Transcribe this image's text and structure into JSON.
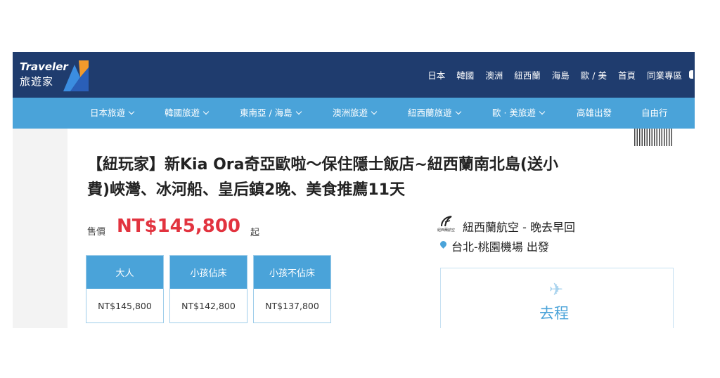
{
  "brand": {
    "name_en": "Traveler",
    "name_zh": "旅遊家"
  },
  "top_nav": [
    "日本",
    "韓國",
    "澳洲",
    "紐西蘭",
    "海島",
    "歐 / 美",
    "首頁",
    "同業專區"
  ],
  "sub_nav": [
    {
      "label": "日本旅遊",
      "dropdown": true
    },
    {
      "label": "韓國旅遊",
      "dropdown": true
    },
    {
      "label": "東南亞 / 海島",
      "dropdown": true
    },
    {
      "label": "澳洲旅遊",
      "dropdown": true
    },
    {
      "label": "紐西蘭旅遊",
      "dropdown": true
    },
    {
      "label": "歐 · 美旅遊",
      "dropdown": true
    },
    {
      "label": "高雄出發",
      "dropdown": false
    },
    {
      "label": "自由行",
      "dropdown": false
    }
  ],
  "tour": {
    "title_line1": "【紐玩家】新Kia Ora奇亞歐啦～保住隱士飯店~紐西蘭南北島(送小",
    "title_line2": "費)峽灣、冰河船、皇后鎮2晚、美食推薦11天",
    "price_label": "售價",
    "price": "NT$145,800",
    "price_suffix": "起",
    "prices": [
      {
        "label": "大人",
        "value": "NT$145,800"
      },
      {
        "label": "小孩佔床",
        "value": "NT$142,800"
      },
      {
        "label": "小孩不佔床",
        "value": "NT$137,800"
      }
    ],
    "airline_logo_text": "紐西蘭航空",
    "airline": "紐西蘭航空 - 晚去早回",
    "departure": "台北-桃園機場 出發",
    "outbound_label": "去程"
  },
  "colors": {
    "top_bar": "#1f3c6e",
    "sub_nav": "#4aa3d9",
    "price": "#e2333f"
  },
  "icons": [
    "traveler-logo-icon",
    "chevron-down-icon",
    "qr-code-icon",
    "airline-logo-icon",
    "map-pin-icon",
    "airplane-icon"
  ]
}
